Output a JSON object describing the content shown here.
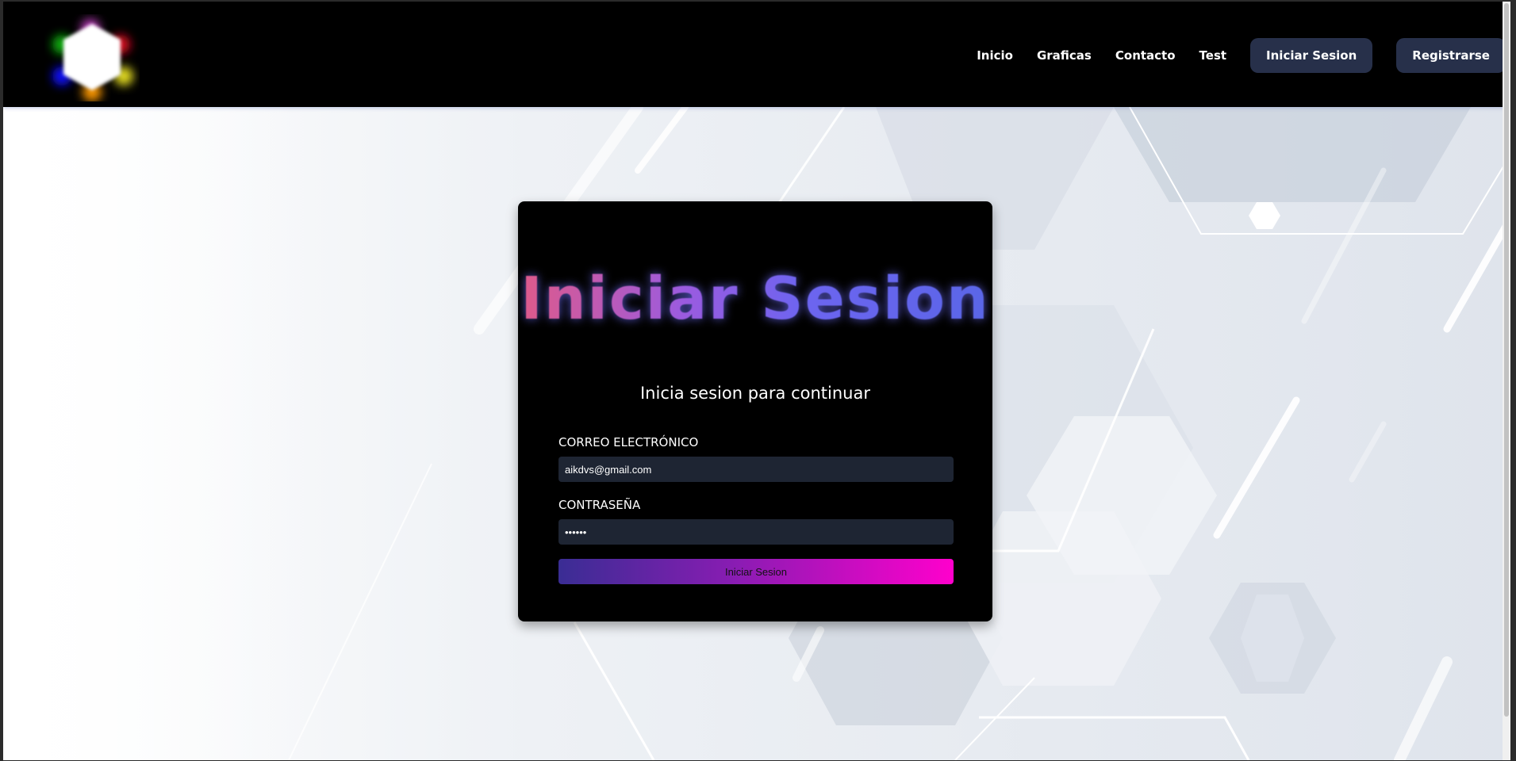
{
  "header": {
    "nav": {
      "inicio": "Inicio",
      "graficas": "Graficas",
      "contacto": "Contacto",
      "test": "Test"
    },
    "login_button": "Iniciar Sesion",
    "register_button": "Registrarse"
  },
  "login_card": {
    "title": "Iniciar Sesion",
    "subtitle": "Inicia sesion para continuar",
    "email_label": "CORREO ELECTRÓNICO",
    "email_value": "aikdvs@gmail.com",
    "password_label": "CONTRASEÑA",
    "password_value": "••••••",
    "submit_label": "Iniciar Sesion"
  },
  "colors": {
    "header_bg": "#000000",
    "nav_button_bg": "#27304a",
    "input_bg": "#1e2533",
    "gradient_start": "#3a2d94",
    "gradient_end": "#ff00cc"
  }
}
